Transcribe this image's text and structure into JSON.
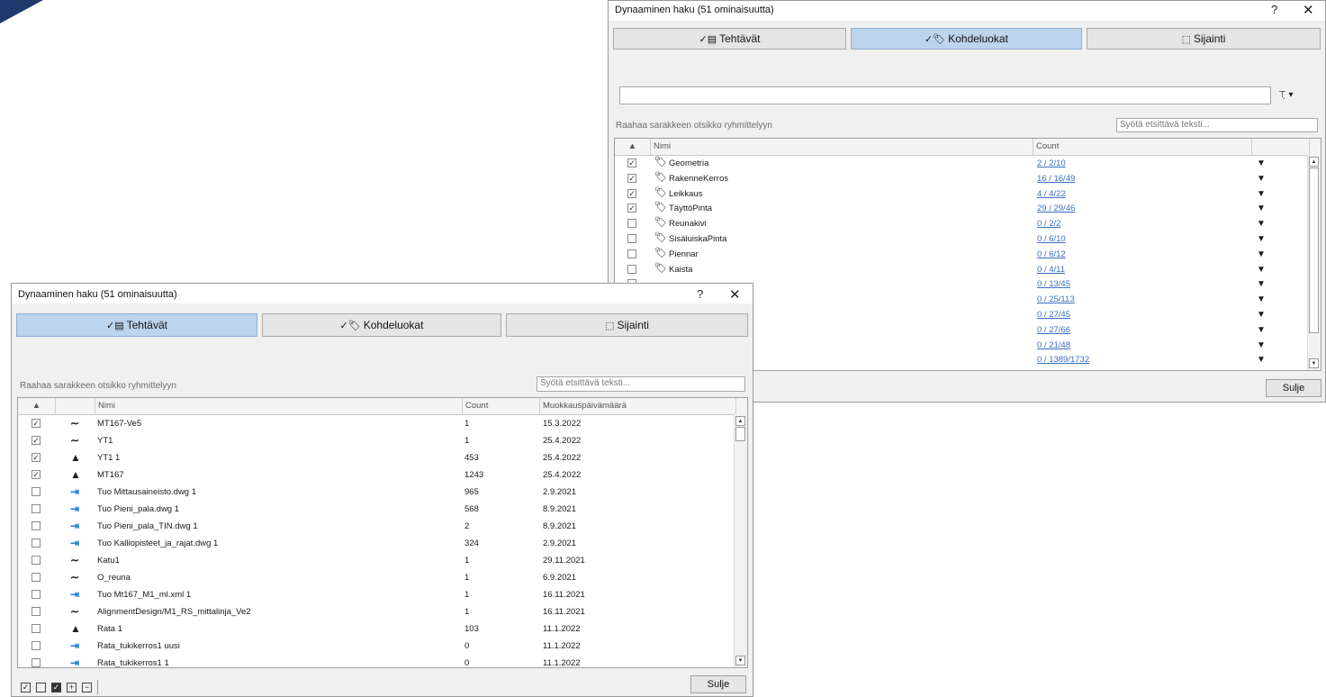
{
  "dialog_back": {
    "title": "Dynaaminen haku (51 ominaisuutta)",
    "help": "?",
    "close": "✕",
    "tabs": [
      {
        "label": "Tehtävät",
        "icon": "✓▤",
        "active": false
      },
      {
        "label": "Kohdeluokat",
        "icon": "✓🏷",
        "active": true
      },
      {
        "label": "Sijainti",
        "icon": "⬚",
        "active": false
      }
    ],
    "filter_icon": "⊤̣ ▾",
    "group_hint": "Raahaa sarakkeen otsikko ryhmittelyyn",
    "search_placeholder": "Syötä etsittävä teksti...",
    "columns": [
      "Nimi",
      "Count"
    ],
    "rows": [
      {
        "checked": true,
        "name": "Geometria",
        "count": "2 / 2/10"
      },
      {
        "checked": true,
        "name": "RakenneKerros",
        "count": "16 / 16/49"
      },
      {
        "checked": true,
        "name": "Leikkaus",
        "count": "4 / 4/22"
      },
      {
        "checked": true,
        "name": "TäyttöPinta",
        "count": "29 / 29/46"
      },
      {
        "checked": false,
        "name": "Reunakivi",
        "count": "0 / 2/2"
      },
      {
        "checked": false,
        "name": "SisäluiskaPinta",
        "count": "0 / 6/10"
      },
      {
        "checked": false,
        "name": "Piennar",
        "count": "0 / 6/12"
      },
      {
        "checked": false,
        "name": "Kaista",
        "count": "0 / 4/11"
      },
      {
        "checked": false,
        "name": "",
        "count": "0 / 13/45"
      },
      {
        "checked": false,
        "name": "",
        "count": "0 / 25/113"
      },
      {
        "checked": false,
        "name": "",
        "count": "0 / 27/45"
      },
      {
        "checked": false,
        "name": "",
        "count": "0 / 27/66"
      },
      {
        "checked": false,
        "name": "",
        "count": "0 / 21/48"
      },
      {
        "checked": false,
        "name": "",
        "count": "0 / 1389/1732"
      }
    ],
    "close_label": "Sulje"
  },
  "dialog_front": {
    "title": "Dynaaminen haku (51 ominaisuutta)",
    "help": "?",
    "close": "✕",
    "tabs": [
      {
        "label": "Tehtävät",
        "icon": "✓▤",
        "active": true
      },
      {
        "label": "Kohdeluokat",
        "icon": "✓🏷",
        "active": false
      },
      {
        "label": "Sijainti",
        "icon": "⬚",
        "active": false
      }
    ],
    "group_hint": "Raahaa sarakkeen otsikko ryhmittelyyn",
    "search_placeholder": "Syötä etsittävä teksti...",
    "columns": [
      "Nimi",
      "Count",
      "Muokkauspäivämäärä"
    ],
    "rows": [
      {
        "checked": true,
        "icon": "alignment",
        "name": "MT167-Ve5",
        "count": "1",
        "date": "15.3.2022"
      },
      {
        "checked": true,
        "icon": "alignment",
        "name": "YT1",
        "count": "1",
        "date": "25.4.2022"
      },
      {
        "checked": true,
        "icon": "road",
        "name": "YT1 1",
        "count": "453",
        "date": "25.4.2022"
      },
      {
        "checked": true,
        "icon": "road",
        "name": "MT167",
        "count": "1243",
        "date": "25.4.2022"
      },
      {
        "checked": false,
        "icon": "import",
        "name": "Tuo Mittausaineisto.dwg 1",
        "count": "965",
        "date": "2.9.2021"
      },
      {
        "checked": false,
        "icon": "import",
        "name": "Tuo Pieni_pala.dwg 1",
        "count": "568",
        "date": "8.9.2021"
      },
      {
        "checked": false,
        "icon": "import",
        "name": "Tuo Pieni_pala_TIN.dwg 1",
        "count": "2",
        "date": "8.9.2021"
      },
      {
        "checked": false,
        "icon": "import",
        "name": "Tuo Kalliopisteet_ja_rajat.dwg 1",
        "count": "324",
        "date": "2.9.2021"
      },
      {
        "checked": false,
        "icon": "alignment",
        "name": "Katu1",
        "count": "1",
        "date": "29.11.2021"
      },
      {
        "checked": false,
        "icon": "alignment",
        "name": "O_reuna",
        "count": "1",
        "date": "6.9.2021"
      },
      {
        "checked": false,
        "icon": "import",
        "name": "Tuo Mt167_M1_ml.xml 1",
        "count": "1",
        "date": "16.11.2021"
      },
      {
        "checked": false,
        "icon": "alignment",
        "name": "AlignmentDesign/M1_RS_mittalinja_Ve2",
        "count": "1",
        "date": "16.11.2021"
      },
      {
        "checked": false,
        "icon": "rail",
        "name": "Rata 1",
        "count": "103",
        "date": "11.1.2022"
      },
      {
        "checked": false,
        "icon": "import",
        "name": "Rata_tukikerros1 uusi",
        "count": "0",
        "date": "11.1.2022"
      },
      {
        "checked": false,
        "icon": "import",
        "name": "Rata_tukikerros1 1",
        "count": "0",
        "date": "11.1.2022"
      }
    ],
    "close_label": "Sulje"
  }
}
